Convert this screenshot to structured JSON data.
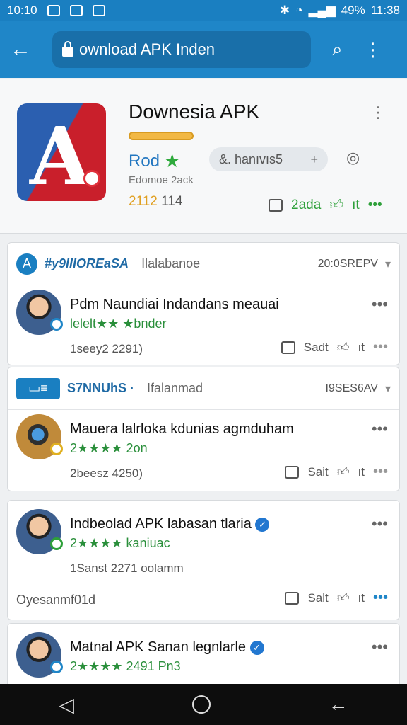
{
  "status_bar": {
    "time_left": "10:10",
    "battery": "49%",
    "time_right": "11:38",
    "icons": [
      "photo-icon",
      "instagram-icon",
      "calendar-icon",
      "bluetooth-icon",
      "wifi-icon",
      "signal-icon"
    ]
  },
  "app_bar": {
    "url": "ownload APK Inden",
    "icons": [
      "back-arrow-icon",
      "lock-icon",
      "search-icon",
      "more-vert-icon"
    ]
  },
  "hero": {
    "title": "Downesia APK",
    "label": "Rod",
    "chip_label": "&. hanıvıs5",
    "sub_label": "Edomoe 2ack",
    "count_a": "2112",
    "count_b": "114",
    "action_label": "2ada",
    "thumb_label": "ıt"
  },
  "cards": [
    {
      "source_name": "#y9lIIOREaSA",
      "source_sub": "Ilalabanoe",
      "source_date": "20:0SREPV",
      "title": "Pdm Naundiai Indandans meauai",
      "stars": "lelelt★★ ★bnder",
      "meta": "1seey2 2291)",
      "action_a": "Sadt",
      "action_b": "ıt"
    },
    {
      "source_name": "S7NNUhS ·",
      "source_sub": "Ifalanmad",
      "source_date": "I9SES6AV",
      "title": "Mauera lalrloka kdunias agmduham",
      "stars": "2★★★★ 2on",
      "meta": "2beesz 4250)",
      "action_a": "Sait",
      "action_b": "ıt"
    },
    {
      "title": "Indbeolad APK labasan tlaria",
      "stars": "2★★★★ kaniuac",
      "meta": "1Sanst 2271 oolamm",
      "action_a": "Salt",
      "action_b": "ıt",
      "extra": "Oyesanmf01d"
    },
    {
      "title": "Matnal APK Sanan legnlarle",
      "stars": "2★★★★ 2491 Pn3"
    }
  ],
  "colors": {
    "primary": "#1f86c8",
    "accent": "#2ea03a",
    "warning": "#f2b844"
  }
}
